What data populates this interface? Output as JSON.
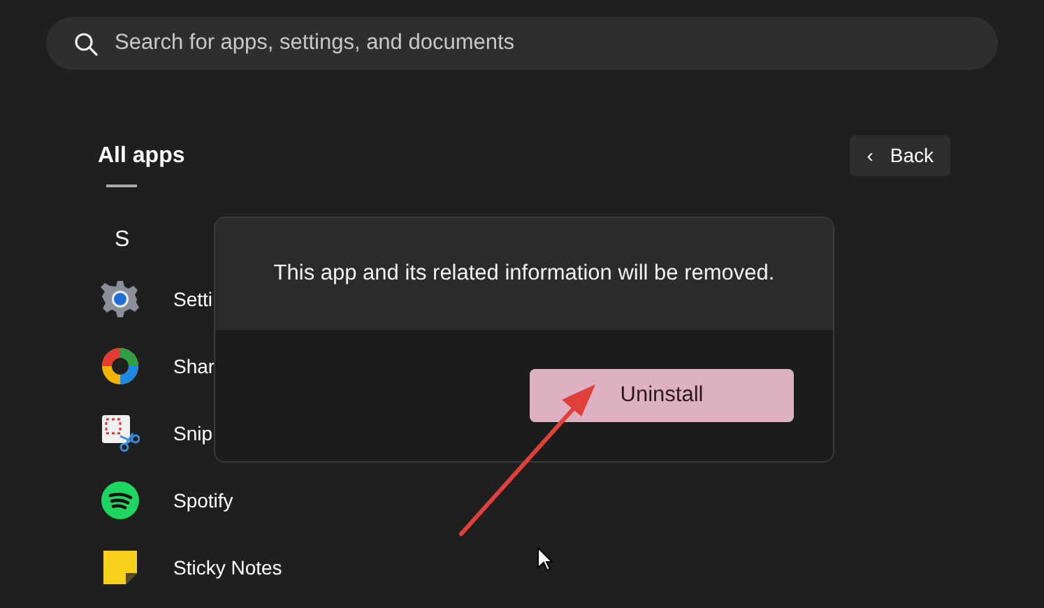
{
  "search": {
    "placeholder": "Search for apps, settings, and documents"
  },
  "header": {
    "title": "All apps",
    "back_button": {
      "label": "Back",
      "icon": "‹"
    }
  },
  "group_letter": "S",
  "apps": [
    {
      "kind": "gear",
      "name": "Setti"
    },
    {
      "kind": "swirl",
      "name": "Shar"
    },
    {
      "kind": "snip",
      "name": "Snip"
    },
    {
      "kind": "music",
      "name": "Spotify"
    },
    {
      "kind": "note",
      "name": "Sticky Notes"
    }
  ],
  "dialog": {
    "message": "This app and its related information will be removed.",
    "button": "Uninstall"
  }
}
